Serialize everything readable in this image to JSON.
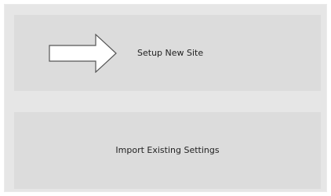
{
  "options": {
    "setup": {
      "label": "Setup New Site",
      "icon": "arrow-right-icon"
    },
    "import": {
      "label": "Import Existing Settings"
    }
  },
  "colors": {
    "window_background": "#e6e6e6",
    "option_background": "#dcdcdc",
    "text": "#222222",
    "arrow_outline": "#555555",
    "arrow_fill": "#ffffff"
  }
}
